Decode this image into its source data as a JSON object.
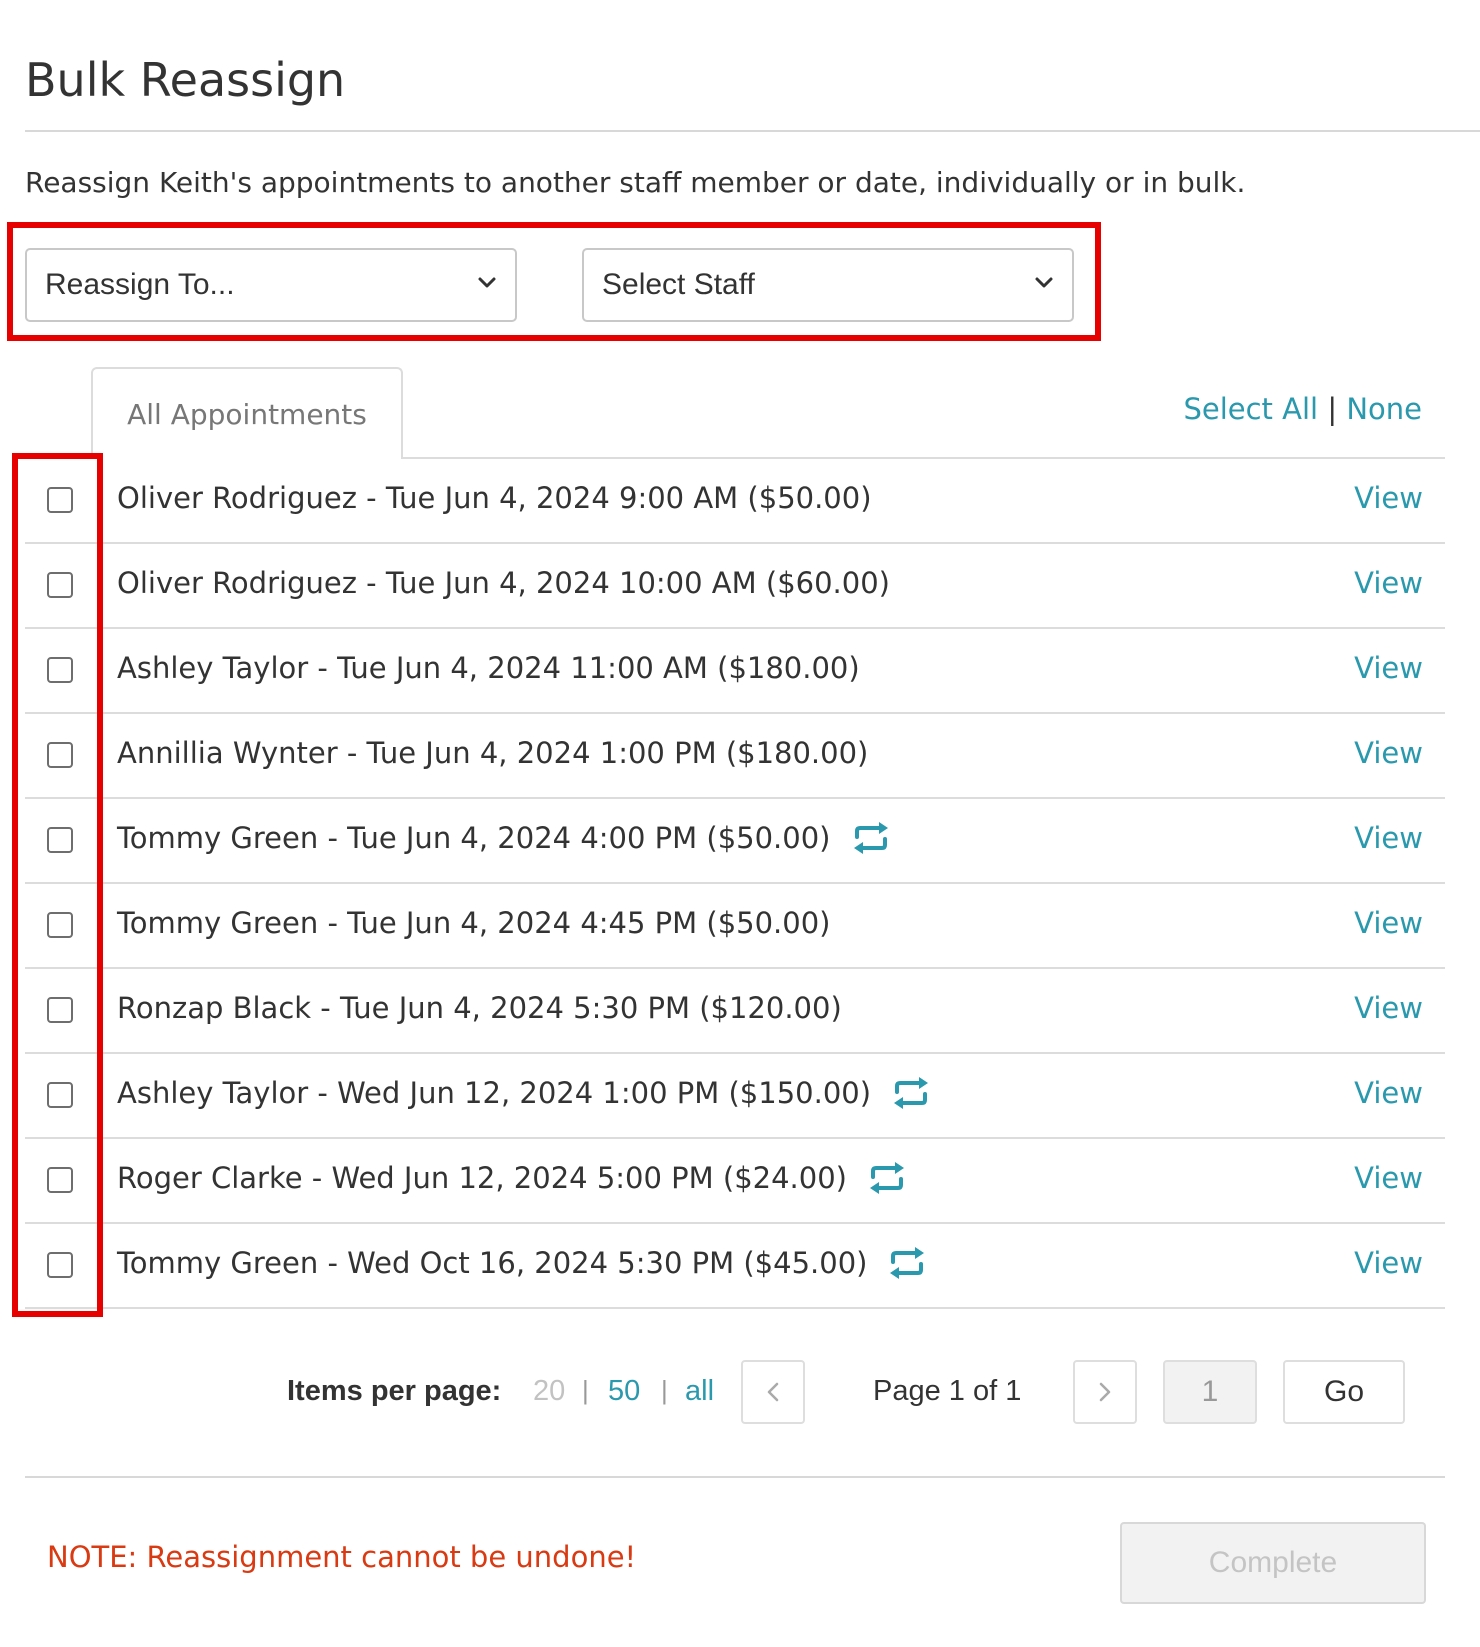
{
  "page": {
    "title": "Bulk Reassign",
    "description": "Reassign Keith's appointments to another staff member or date, individually or in bulk."
  },
  "filters": {
    "reassign_to": "Reassign To...",
    "select_staff": "Select Staff"
  },
  "tabs": [
    {
      "label": "All Appointments",
      "active": true
    }
  ],
  "selection": {
    "select_all": "Select All",
    "separator": "|",
    "none": "None"
  },
  "appointments": [
    {
      "label": "Oliver Rodriguez - Tue Jun 4, 2024 9:00 AM ($50.00)",
      "recurring": false,
      "checked": false,
      "action": "View"
    },
    {
      "label": "Oliver Rodriguez - Tue Jun 4, 2024 10:00 AM ($60.00)",
      "recurring": false,
      "checked": false,
      "action": "View"
    },
    {
      "label": "Ashley Taylor - Tue Jun 4, 2024 11:00 AM ($180.00)",
      "recurring": false,
      "checked": false,
      "action": "View"
    },
    {
      "label": "Annillia Wynter - Tue Jun 4, 2024 1:00 PM ($180.00)",
      "recurring": false,
      "checked": false,
      "action": "View"
    },
    {
      "label": "Tommy Green - Tue Jun 4, 2024 4:00 PM ($50.00)",
      "recurring": true,
      "checked": false,
      "action": "View"
    },
    {
      "label": "Tommy Green - Tue Jun 4, 2024 4:45 PM ($50.00)",
      "recurring": false,
      "checked": false,
      "action": "View"
    },
    {
      "label": "Ronzap Black - Tue Jun 4, 2024 5:30 PM ($120.00)",
      "recurring": false,
      "checked": false,
      "action": "View"
    },
    {
      "label": "Ashley Taylor - Wed Jun 12, 2024 1:00 PM ($150.00)",
      "recurring": true,
      "checked": false,
      "action": "View"
    },
    {
      "label": "Roger Clarke - Wed Jun 12, 2024 5:00 PM ($24.00)",
      "recurring": true,
      "checked": false,
      "action": "View"
    },
    {
      "label": "Tommy Green - Wed Oct 16, 2024 5:30 PM ($45.00)",
      "recurring": true,
      "checked": false,
      "action": "View"
    }
  ],
  "pagination": {
    "items_per_page_label": "Items per page:",
    "options": [
      "20",
      "50",
      "all"
    ],
    "selected_option": "20",
    "prev_icon": "chevron-left-icon",
    "page_text": "Page 1 of 1",
    "next_icon": "chevron-right-icon",
    "page_input": "1",
    "go_label": "Go"
  },
  "footer": {
    "note": "NOTE: Reassignment cannot be undone!",
    "complete_label": "Complete"
  },
  "colors": {
    "link": "#2a98ad",
    "note": "#d93a12",
    "highlight": "#e60000"
  },
  "icons": {
    "recurring": "repeat-icon",
    "dropdown": "chevron-down-icon"
  }
}
